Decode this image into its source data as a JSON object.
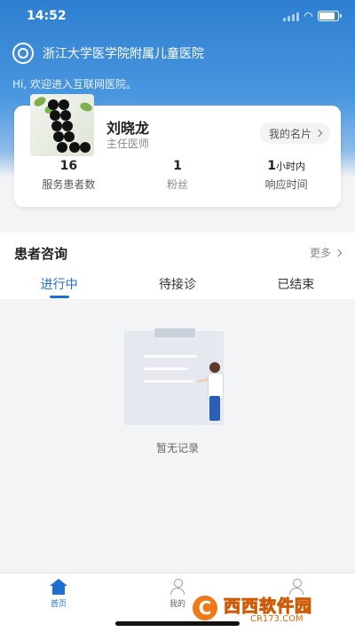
{
  "status_bar": {
    "time": "14:52"
  },
  "header": {
    "hospital_name": "浙江大学医学院附属儿童医院",
    "welcome": "Hi, 欢迎进入互联网医院。"
  },
  "profile": {
    "name": "刘晓龙",
    "title": "主任医师",
    "card_button": "我的名片",
    "stats": [
      {
        "value": "16",
        "unit": "",
        "label": "服务患者数"
      },
      {
        "value": "1",
        "unit": "",
        "label": "粉丝"
      },
      {
        "value": "1",
        "unit": "小时内",
        "label": "响应时间"
      }
    ]
  },
  "consult": {
    "title": "患者咨询",
    "more": "更多",
    "tabs": [
      "进行中",
      "待接诊",
      "已结束"
    ],
    "active_tab": 0,
    "empty_text": "暂无记录"
  },
  "tab_bar": {
    "items": [
      {
        "label": "首页",
        "icon": "home-icon",
        "active": true
      },
      {
        "label": "我的",
        "icon": "person-icon",
        "active": false
      }
    ]
  },
  "watermark": {
    "main": "西西软件园",
    "sub": "CR173.COM",
    "logo": "C"
  },
  "colors": {
    "primary": "#1f6fd1",
    "header": "#2e7fd1"
  }
}
